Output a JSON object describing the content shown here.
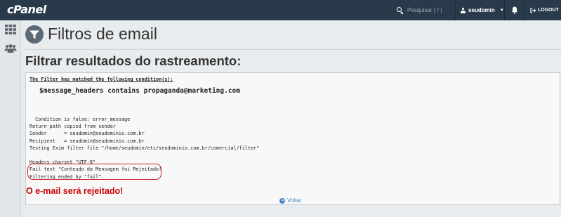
{
  "topbar": {
    "logo": "cPanel",
    "search_placeholder": "Pesquisar ( / )",
    "username": "seudomin",
    "logout_label": "LOGOUT"
  },
  "sidebar": {
    "items": [
      {
        "name": "grid-icon"
      },
      {
        "name": "users-icon"
      }
    ]
  },
  "page": {
    "title": "Filtros de email",
    "section_title": "Filtrar resultados do rastreamento:"
  },
  "output": {
    "condition_title": "The Filter has matched the following condition(s):",
    "condition_expr": "$message_headers contains propaganda@marketing.com",
    "log_text": "  Condition is false: error_message\nReturn-path copied from sender\nSender      = seudomin@seudominio.com.br\nRecipient   = seudomin@seudominio.com.br\nTesting Exim filter file \"/home/seudomin/etc/seudominio.com.br/comercial/filter\"\n\nHeaders charset \"UTF-8\"\nFail text \"Conteudo da Mensagem foi Rejeitado!\nFiltering ended by \"fail\"."
  },
  "result": {
    "message": "O e-mail será rejeitado!",
    "color": "#cc0000"
  },
  "back_label": "Voltar",
  "colors": {
    "topbar": "#293a4a",
    "link": "#4a86c7",
    "highlight": "#cc2222"
  }
}
